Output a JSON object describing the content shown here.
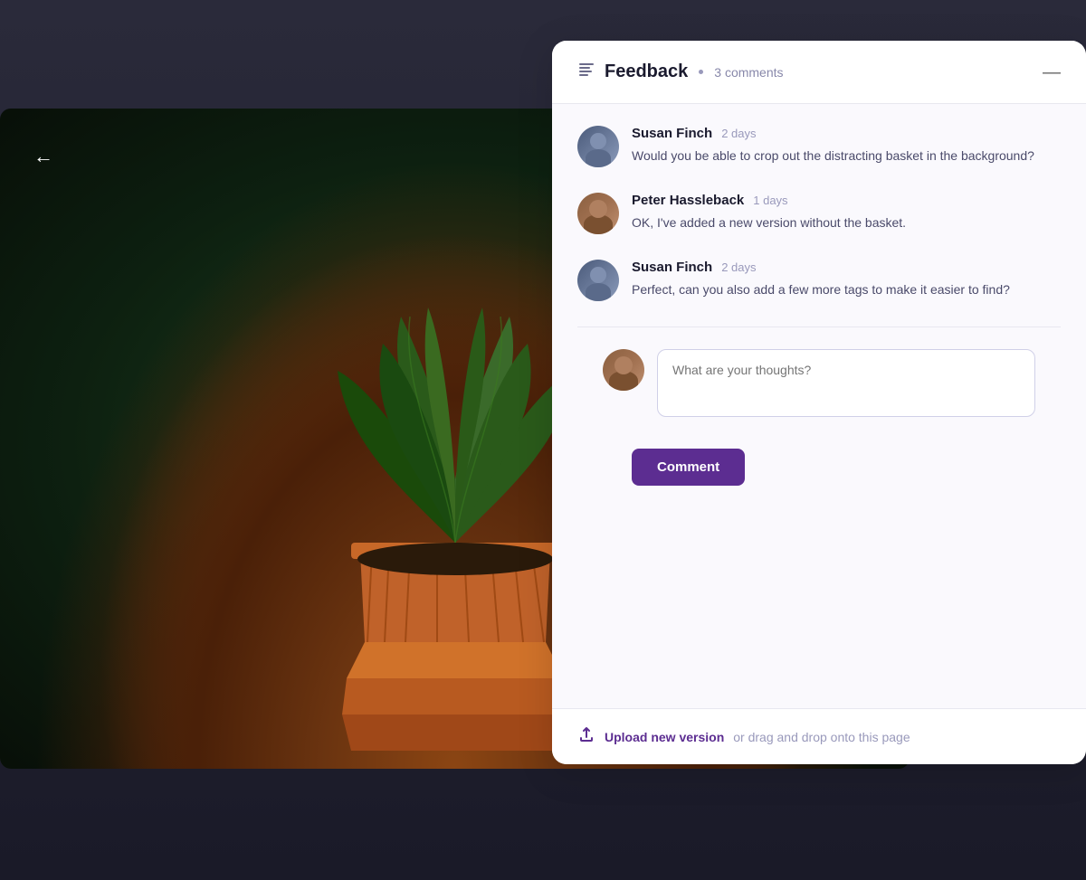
{
  "page": {
    "background_color": "#2a2a3a"
  },
  "back_button": {
    "label": "←"
  },
  "feedback_panel": {
    "title": "Feedback",
    "dot": "·",
    "comment_count": "3 comments",
    "minimize_label": "—"
  },
  "comments": [
    {
      "id": "comment-1",
      "author": "Susan Finch",
      "time": "2 days",
      "text": "Would you be able to crop out the distracting basket in the background?",
      "avatar_type": "susan"
    },
    {
      "id": "comment-2",
      "author": "Peter Hassleback",
      "time": "1 days",
      "text": "OK, I've added a new version without the basket.",
      "avatar_type": "peter"
    },
    {
      "id": "comment-3",
      "author": "Susan Finch",
      "time": "2 days",
      "text": "Perfect, can you also add a few more tags to make it easier to find?",
      "avatar_type": "susan"
    }
  ],
  "reply": {
    "author": "Peter Hassleback",
    "avatar_type": "peter",
    "textarea_placeholder": "What are your thoughts?",
    "button_label": "Comment"
  },
  "upload": {
    "icon": "⬆",
    "link_label": "Upload new version",
    "separator": "or drag and drop onto this page"
  }
}
